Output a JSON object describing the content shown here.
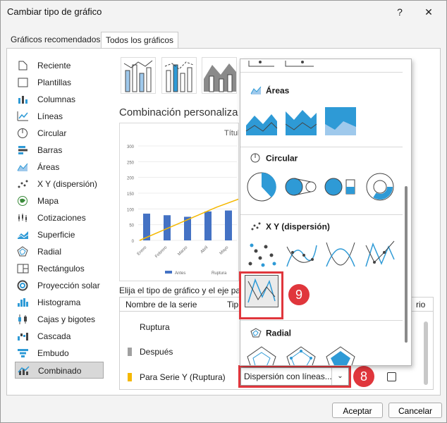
{
  "window": {
    "title": "Cambiar tipo de gráfico",
    "help_glyph": "?",
    "close_glyph": "✕"
  },
  "tabs": [
    {
      "label": "Gráficos recomendados",
      "selected": false
    },
    {
      "label": "Todos los gráficos",
      "selected": true
    }
  ],
  "sidebar": {
    "items": [
      {
        "label": "Reciente",
        "icon": "recent-icon"
      },
      {
        "label": "Plantillas",
        "icon": "templates-icon"
      },
      {
        "label": "Columnas",
        "icon": "column-chart-icon"
      },
      {
        "label": "Líneas",
        "icon": "line-chart-icon"
      },
      {
        "label": "Circular",
        "icon": "pie-chart-icon"
      },
      {
        "label": "Barras",
        "icon": "bar-chart-icon"
      },
      {
        "label": "Áreas",
        "icon": "area-chart-icon"
      },
      {
        "label": "X Y (dispersión)",
        "icon": "scatter-chart-icon"
      },
      {
        "label": "Mapa",
        "icon": "map-chart-icon"
      },
      {
        "label": "Cotizaciones",
        "icon": "stock-chart-icon"
      },
      {
        "label": "Superficie",
        "icon": "surface-chart-icon"
      },
      {
        "label": "Radial",
        "icon": "radar-chart-icon"
      },
      {
        "label": "Rectángulos",
        "icon": "treemap-chart-icon"
      },
      {
        "label": "Proyección solar",
        "icon": "sunburst-chart-icon"
      },
      {
        "label": "Histograma",
        "icon": "histogram-chart-icon"
      },
      {
        "label": "Cajas y bigotes",
        "icon": "box-whisker-chart-icon"
      },
      {
        "label": "Cascada",
        "icon": "waterfall-chart-icon"
      },
      {
        "label": "Embudo",
        "icon": "funnel-chart-icon"
      },
      {
        "label": "Combinado",
        "icon": "combo-chart-icon",
        "selected": true
      }
    ]
  },
  "main": {
    "combo_title": "Combinación personaliza",
    "chart_preview_title": "Títul",
    "series_prompt": "Elija el tipo de gráfico y el eje pa",
    "grid": {
      "col_name": "Nombre de la serie",
      "col_type": "Tip",
      "col_secondary": "rio",
      "rows": [
        {
          "name": "Ruptura",
          "color": ""
        },
        {
          "name": "Después",
          "color": "#a0a0a0"
        },
        {
          "name": "Para Serie Y (Ruptura)",
          "color": "#f5b800"
        }
      ]
    },
    "selected_type": "Dispersión con líneas...",
    "arrow_glyph": "⌄"
  },
  "chart_data": {
    "type": "bar",
    "title": "Títul",
    "categories": [
      "Enero",
      "Febrero",
      "Marzo",
      "Abril",
      "Mayo"
    ],
    "series": [
      {
        "name": "Antes",
        "values": [
          85,
          80,
          75,
          92,
          95
        ],
        "color": "#4472c4"
      }
    ],
    "line_series": {
      "name": "Ruptura",
      "color": "#f5b800",
      "values": [
        0,
        35,
        70,
        105,
        135
      ]
    },
    "y_ticks": [
      "300",
      "250",
      "200",
      "150",
      "100",
      "50",
      "0"
    ],
    "ylim": [
      0,
      300
    ],
    "legend": [
      "Antes",
      "Ruptura"
    ],
    "legend_position": "bottom"
  },
  "dropdown": {
    "sections": [
      {
        "label": "Áreas",
        "icon": "area-chart-icon"
      },
      {
        "label": "Circular",
        "icon": "pie-chart-icon"
      },
      {
        "label": "X Y (dispersión)",
        "icon": "scatter-chart-icon"
      },
      {
        "label": "Radial",
        "icon": "radar-chart-icon"
      }
    ],
    "highlighted_option": "scatter-straight-lines-icon"
  },
  "callouts": [
    {
      "label": "9"
    },
    {
      "label": "8"
    }
  ],
  "colors": {
    "accent_blue": "#2e9ad6",
    "highlight_red": "#e0363c",
    "bar_blue": "#4472c4",
    "line_yellow": "#f5b800"
  },
  "buttons": {
    "ok": "Aceptar",
    "cancel": "Cancelar"
  }
}
